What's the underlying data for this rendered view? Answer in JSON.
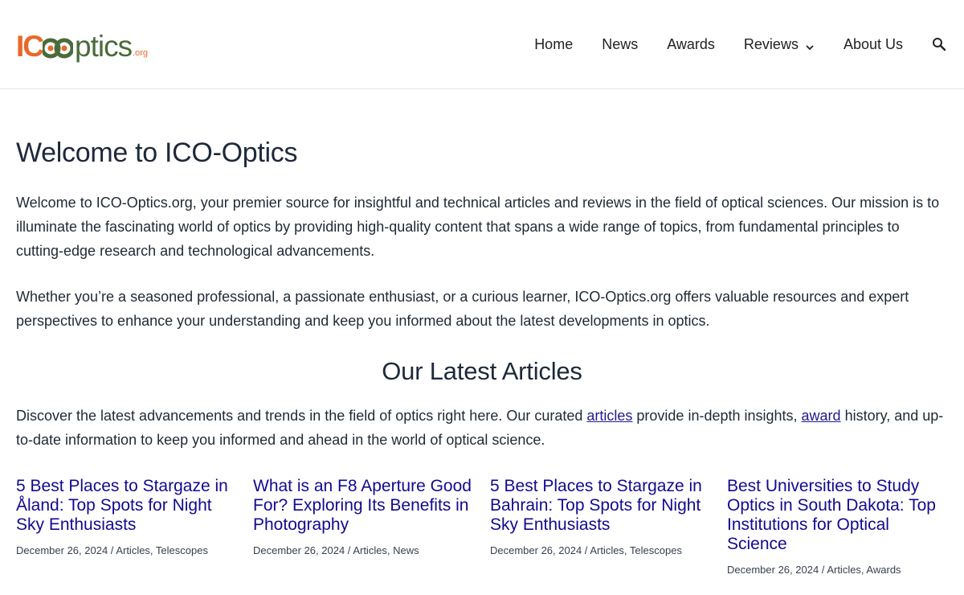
{
  "logo": {
    "part_ico": "IC",
    "part_optics": "ptics",
    "part_org": ".org",
    "colors": {
      "orange": "#e8692a",
      "green": "#4a6b3a"
    }
  },
  "nav": {
    "items": [
      {
        "label": "Home"
      },
      {
        "label": "News"
      },
      {
        "label": "Awards"
      },
      {
        "label": "Reviews"
      },
      {
        "label": "About Us"
      }
    ],
    "search_icon": "search-icon"
  },
  "page": {
    "title": "Welcome to ICO-Optics",
    "intro_1": "Welcome to ICO-Optics.org, your premier source for insightful and technical articles and reviews in the field of optical sciences. Our mission is to illuminate the fascinating world of optics by providing high-quality content that spans a wide range of topics, from fundamental principles to cutting-edge research and technological advancements.",
    "intro_2": "Whether you’re a seasoned professional, a passionate enthusiast, or a curious learner, ICO-Optics.org offers valuable resources and expert perspectives to enhance your understanding and keep you informed about the latest developments in optics."
  },
  "latest": {
    "title": "Our Latest Articles",
    "desc_part1": "Discover the latest advancements and trends in the field of optics right here. Our curated ",
    "desc_link1": "articles",
    "desc_part2": " provide in-depth insights, ",
    "desc_link2": "award",
    "desc_part3": " history, and up-to-date information to keep you informed and ahead in the world of optical science.",
    "articles": [
      {
        "title": "5 Best Places to Stargaze in Åland: Top Spots for Night Sky Enthusiasts",
        "date": "December 26, 2024",
        "sep": " / ",
        "categories": "Articles, Telescopes"
      },
      {
        "title": "What is an F8 Aperture Good For? Exploring Its Benefits in Photography",
        "date": "December 26, 2024",
        "sep": " / ",
        "categories": "Articles, News"
      },
      {
        "title": "5 Best Places to Stargaze in Bahrain: Top Spots for Night Sky Enthusiasts",
        "date": "December 26, 2024",
        "sep": " / ",
        "categories": "Articles, Telescopes"
      },
      {
        "title": "Best Universities to Study Optics in South Dakota: Top Institutions for Optical Science",
        "date": "December 26, 2024",
        "sep": " / ",
        "categories": "Articles, Awards"
      }
    ]
  },
  "colors": {
    "link": "#120a8f",
    "text": "#1f2937",
    "heading": "#1e293b"
  }
}
